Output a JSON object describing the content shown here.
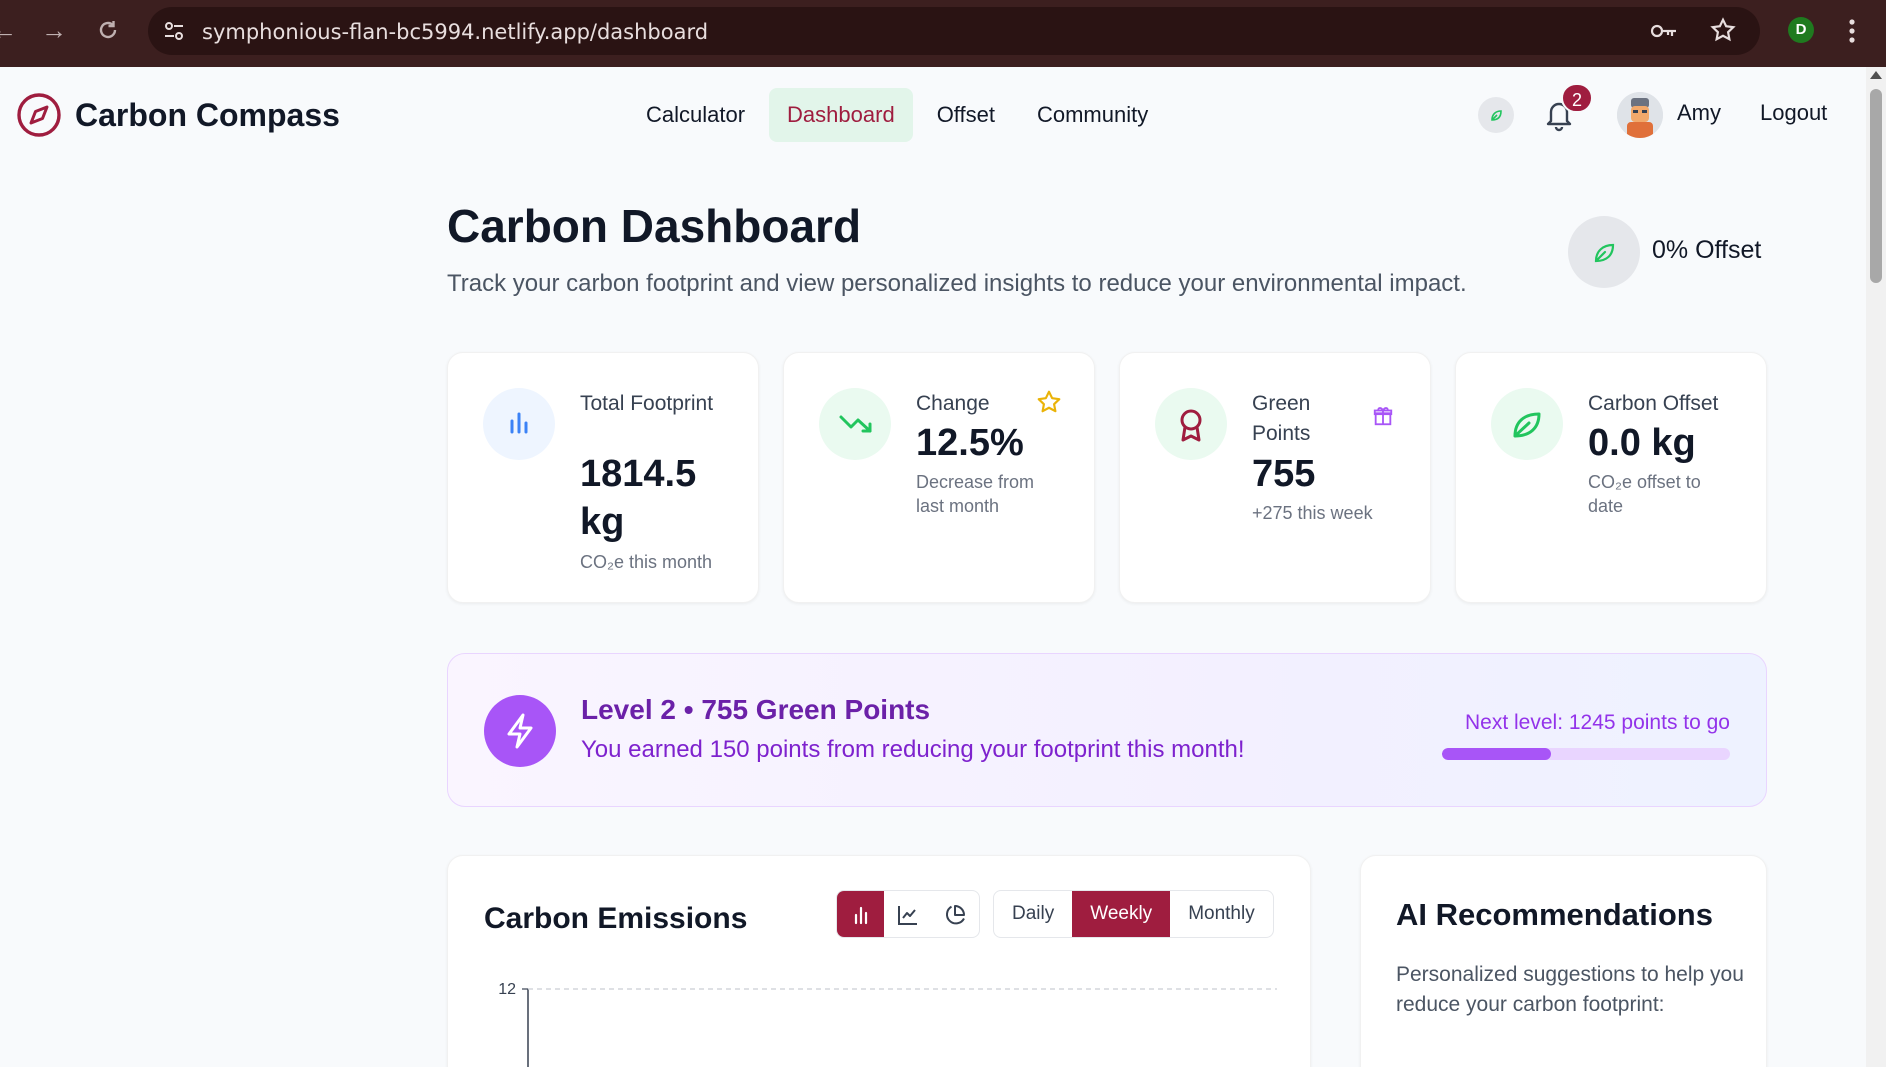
{
  "browser": {
    "url": "symphonious-flan-bc5994.netlify.app/dashboard",
    "profile_initial": "D"
  },
  "app": {
    "brand": "Carbon Compass",
    "nav": [
      {
        "label": "Calculator",
        "active": false
      },
      {
        "label": "Dashboard",
        "active": true
      },
      {
        "label": "Offset",
        "active": false
      },
      {
        "label": "Community",
        "active": false
      }
    ],
    "notification_count": "2",
    "user_name": "Amy",
    "logout_label": "Logout"
  },
  "page": {
    "title": "Carbon Dashboard",
    "subtitle": "Track your carbon footprint and view personalized insights to reduce your environmental impact.",
    "offset_pill": "0% Offset"
  },
  "stats": [
    {
      "label": "Total Footprint",
      "value": "1814.5 kg",
      "sub": "CO₂e this month",
      "icon": "bar-chart-icon"
    },
    {
      "label": "Change",
      "value": "12.5%",
      "sub": "Decrease from last month",
      "icon": "trending-down-icon",
      "corner_icon": "star-icon"
    },
    {
      "label": "Green Points",
      "value": "755",
      "sub": "+275 this week",
      "icon": "award-icon",
      "corner_icon": "gift-icon"
    },
    {
      "label": "Carbon Offset",
      "value": "0.0 kg",
      "sub": "CO₂e offset to date",
      "icon": "leaf-icon"
    }
  ],
  "level": {
    "title": "Level 2 • 755 Green Points",
    "desc": "You earned 150 points from reducing your footprint this month!",
    "next": "Next level: 1245 points to go",
    "progress": 0.38
  },
  "emissions": {
    "title": "Carbon Emissions",
    "chart_types": [
      "bar-chart-icon",
      "line-chart-icon",
      "pie-chart-icon"
    ],
    "active_chart_type": "bar-chart-icon",
    "periods": [
      {
        "label": "Daily",
        "active": false
      },
      {
        "label": "Weekly",
        "active": true
      },
      {
        "label": "Monthly",
        "active": false
      }
    ],
    "y_tick_top": "12"
  },
  "ai": {
    "title": "AI Recommendations",
    "desc": "Personalized suggestions to help you reduce your carbon footprint:"
  },
  "colors": {
    "brand": "#9f1d3f",
    "purple": "#a855f7",
    "green": "#22c55e",
    "blue": "#3b82f6"
  }
}
